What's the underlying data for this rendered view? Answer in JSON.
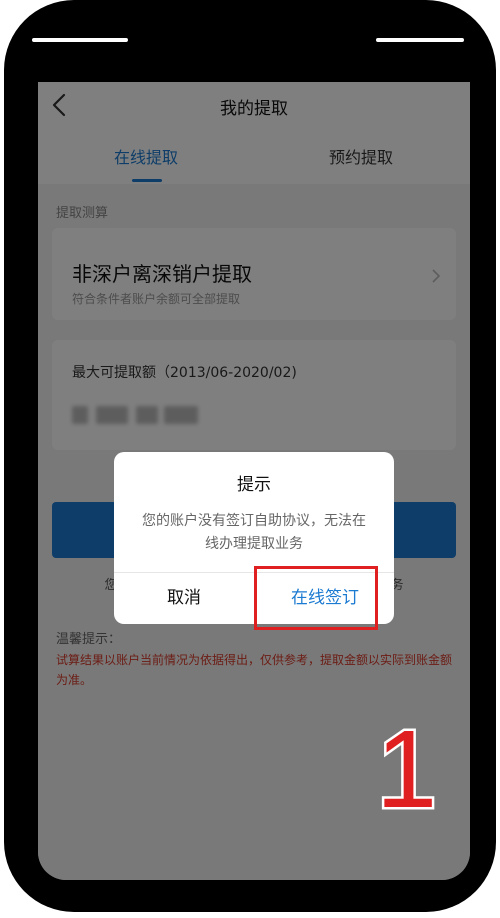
{
  "nav": {
    "title": "我的提取",
    "back_icon": "chevron-left-icon"
  },
  "tabs": [
    {
      "label": "在线提取",
      "active": true
    },
    {
      "label": "预约提取",
      "active": false
    }
  ],
  "section_label": "提取测算",
  "withdraw_card": {
    "title": "非深户离深销户提取",
    "subtitle": "符合条件者账户余额可全部提取"
  },
  "amount_card": {
    "label": "最大可提取额（2013/06-2020/02)"
  },
  "agreement_text": "您的账户没有签订自助协议，无法在线办理提取业务",
  "tips": {
    "label": "温馨提示：",
    "text": "试算结果以账户当前情况为依据得出，仅供参考，提取金额以实际到账金额为准。"
  },
  "dialog": {
    "title": "提示",
    "message": "您的账户没有签订自助协议，无法在线办理提取业务",
    "cancel_label": "取消",
    "confirm_label": "在线签订"
  },
  "annotation": {
    "step_number": "1"
  },
  "colors": {
    "accent": "#1b7ad1",
    "warning": "#d93a2b",
    "highlight": "#e02020"
  }
}
